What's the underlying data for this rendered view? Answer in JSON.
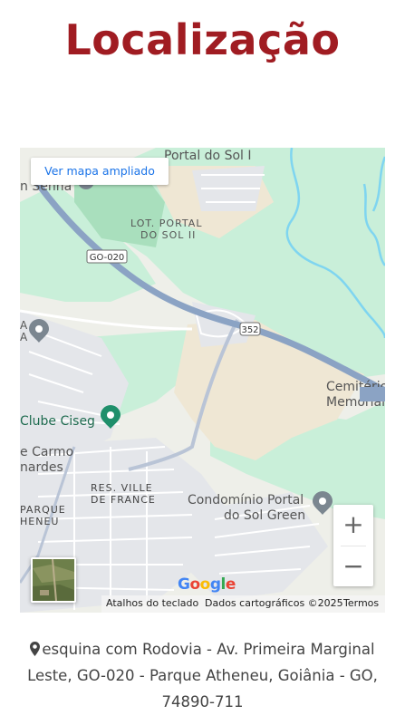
{
  "page": {
    "title": "Localização"
  },
  "map": {
    "view_larger": "Ver mapa ampliado",
    "zoom_in": "+",
    "zoom_out": "−",
    "google_logo": "Google",
    "attribution": {
      "shortcuts": "Atalhos do teclado",
      "map_data": "Dados cartográficos ©2025",
      "terms": "Termos"
    },
    "labels": {
      "portal_sol_i": "Portal do Sol I",
      "senna": "n Senna",
      "lot_portal_1": "LOT. PORTAL",
      "lot_portal_2": "DO SOL II",
      "go020": "GO-020",
      "shield_352": "352",
      "cemiterio_1": "Cemitério",
      "cemiterio_2": "Memorial de",
      "clube": "Clube Ciseg",
      "carmo_1": "e Carmo",
      "carmo_2": "nardes",
      "res_ville_1": "RES. VILLE",
      "res_ville_2": "DE FRANCE",
      "condominio_1": "Condomínio Portal",
      "condominio_2": "do Sol Green",
      "parque_1": "PARQUE",
      "parque_2": "HENEU",
      "a1": "A",
      "a2": "A"
    },
    "colors": {
      "water": "#7fd5f0",
      "park": "#c7eed7",
      "road_major": "#8ba3c4",
      "pin_gray": "#7b8690",
      "pin_green": "#1f8f6b"
    }
  },
  "address": {
    "line1": "esquina com Rodovia - Av. Primeira Marginal",
    "line2": "Leste, GO-020 - Parque Atheneu, Goiânia - GO,",
    "line3": "74890-711",
    "icon": "map-marker-icon"
  }
}
